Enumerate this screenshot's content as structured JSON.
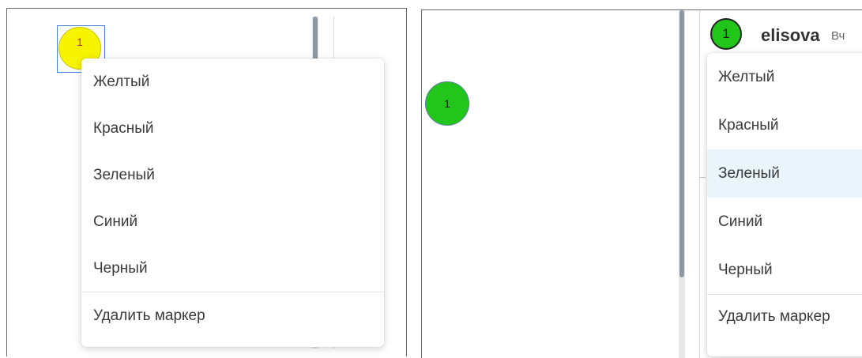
{
  "left": {
    "marker": {
      "label": "1",
      "color": "#f6f400"
    },
    "menu": {
      "items": [
        "Желтый",
        "Красный",
        "Зеленый",
        "Синий",
        "Черный"
      ],
      "delete": "Удалить маркер"
    }
  },
  "right": {
    "marker": {
      "label": "1",
      "color": "#22c51a"
    },
    "header_marker": {
      "label": "1",
      "color": "#22c51a"
    },
    "user": {
      "name": "elisova",
      "time": "Вч"
    },
    "menu": {
      "items": [
        "Желтый",
        "Красный",
        "Зеленый",
        "Синий",
        "Черный"
      ],
      "delete": "Удалить маркер",
      "highlighted": "Зеленый"
    }
  }
}
